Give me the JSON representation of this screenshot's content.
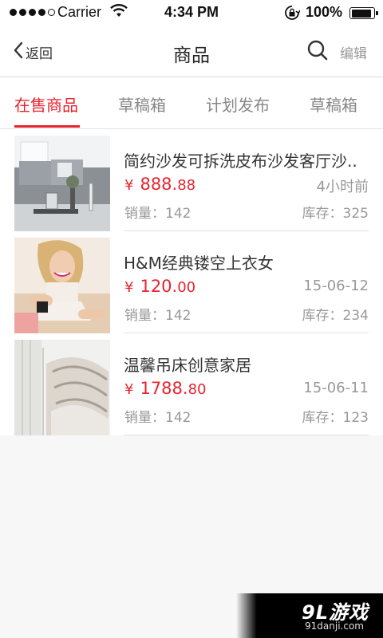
{
  "status_bar": {
    "carrier": "Carrier",
    "time": "4:34 PM",
    "battery": "100%"
  },
  "nav": {
    "back_label": "返回",
    "title": "商品",
    "edit_label": "编辑"
  },
  "tabs": [
    {
      "label": "在售商品",
      "active": true
    },
    {
      "label": "草稿箱",
      "active": false
    },
    {
      "label": "计划发布",
      "active": false
    },
    {
      "label": "草稿箱",
      "active": false
    }
  ],
  "products": [
    {
      "title": "简约沙发可拆洗皮布沙发客厅沙..",
      "currency": "¥",
      "price_main": "888.",
      "price_cents": "88",
      "time": "4小时前",
      "sales": "销量：142",
      "stock": "库存：325"
    },
    {
      "title": "H&M经典镂空上衣女",
      "currency": "¥",
      "price_main": "120.",
      "price_cents": "00",
      "time": "15-06-12",
      "sales": "销量：142",
      "stock": "库存：234"
    },
    {
      "title": "温馨吊床创意家居",
      "currency": "¥",
      "price_main": "1788.",
      "price_cents": "80",
      "time": "15-06-11",
      "sales": "销量：142",
      "stock": "库存：123"
    }
  ],
  "colors": {
    "accent": "#e8242e",
    "muted": "#999999",
    "background": "#f7f7f7"
  },
  "icons": [
    "signal-dots-icon",
    "wifi-icon",
    "rotation-lock-icon",
    "battery-icon",
    "back-chevron-icon",
    "search-icon"
  ],
  "watermark": {
    "logo": "9L游戏",
    "url": "91danji.com"
  }
}
